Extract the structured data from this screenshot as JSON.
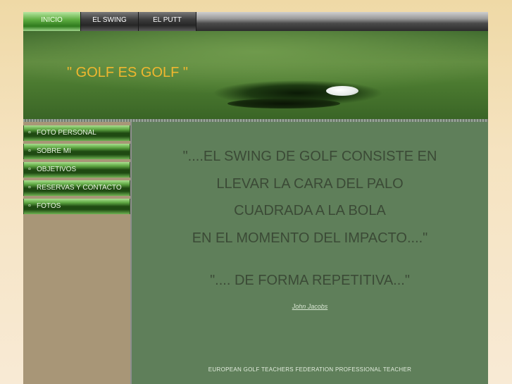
{
  "nav": {
    "tabs": [
      {
        "label": "INICIO",
        "active": true
      },
      {
        "label": "EL SWING",
        "active": false
      },
      {
        "label": "EL PUTT",
        "active": false
      }
    ]
  },
  "banner": {
    "title": "\" GOLF ES GOLF \""
  },
  "sidebar": {
    "items": [
      {
        "label": "FOTO PERSONAL"
      },
      {
        "label": "SOBRE MI"
      },
      {
        "label": "OBJETIVOS"
      },
      {
        "label": "RESERVAS Y CONTACTO"
      },
      {
        "label": "FOTOS"
      }
    ],
    "bullet": "¤"
  },
  "content": {
    "quote_lines": [
      "\"....EL SWING DE GOLF CONSISTE EN",
      "LLEVAR LA CARA DEL PALO",
      "CUADRADA A LA BOLA",
      "EN EL MOMENTO DEL IMPACTO....\"",
      "\".... DE FORMA REPETITIVA...\""
    ],
    "author": "John Jacobs",
    "footer": "EUROPEAN GOLF TEACHERS FEDERATION PROFESSIONAL TEACHER"
  },
  "colors": {
    "title": "#f0b72f",
    "content_bg": "#5f7f5a",
    "sidebar_bg": "#a89677",
    "quote_text": "#3b4a36"
  }
}
